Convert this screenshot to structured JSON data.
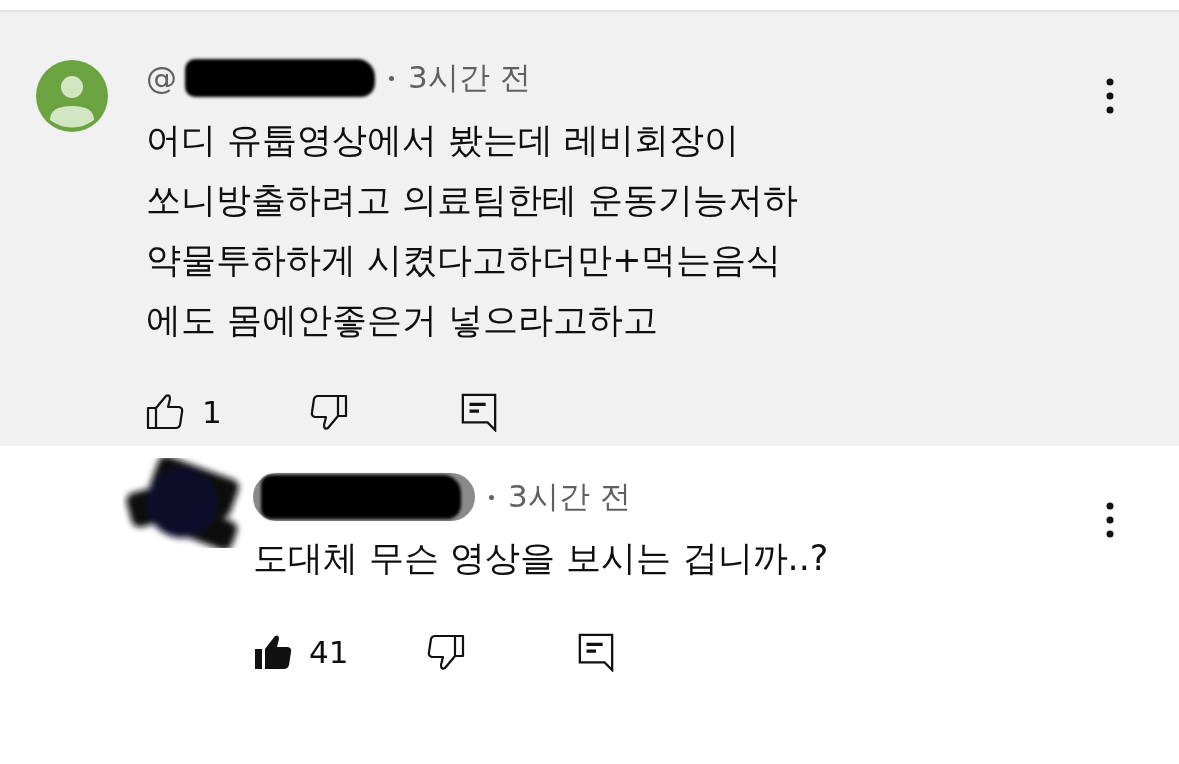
{
  "comments": [
    {
      "highlighted": true,
      "kind": "account",
      "name_chip": false,
      "name_hidden": true,
      "handle_prefix": "@",
      "time": "3시간 전",
      "lines": [
        "어디 유툽영상에서 봤는데 레비회장이",
        "쏘니방출하려고 의료팀한테 운동기능저하",
        "약물투하하게 시켰다고하더만+먹는음식",
        "에도 몸에안좋은거 넣으라고하고"
      ],
      "liked": false,
      "like_count": "1",
      "children": [
        {
          "highlighted": false,
          "kind": "censored",
          "name_chip": true,
          "name_hidden": true,
          "time": "3시간 전",
          "lines": [
            "도대체 무슨 영상을 보시는 겁니까..?"
          ],
          "liked": true,
          "like_count": "41"
        }
      ]
    }
  ]
}
